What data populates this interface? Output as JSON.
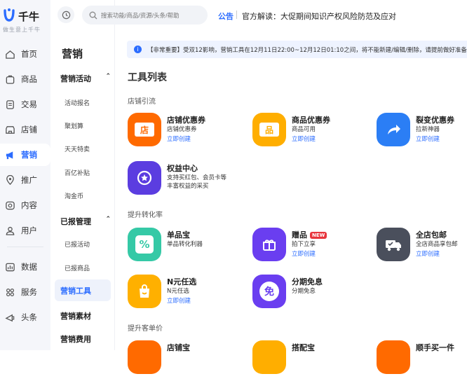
{
  "brand": {
    "name": "千牛",
    "slogan": "做生意上千牛"
  },
  "rail": [
    {
      "label": "首页",
      "icon": "home-icon"
    },
    {
      "label": "商品",
      "icon": "goods-icon"
    },
    {
      "label": "交易",
      "icon": "trade-icon"
    },
    {
      "label": "店铺",
      "icon": "shop-icon"
    },
    {
      "label": "营销",
      "icon": "megaphone-icon",
      "active": true
    },
    {
      "label": "推广",
      "icon": "location-icon"
    },
    {
      "label": "内容",
      "icon": "content-icon"
    },
    {
      "label": "用户",
      "icon": "user-icon"
    },
    {
      "label": "数据",
      "icon": "data-icon"
    },
    {
      "label": "服务",
      "icon": "service-icon"
    },
    {
      "label": "头条",
      "icon": "news-icon"
    }
  ],
  "subnav": {
    "title": "营销",
    "groups": [
      {
        "label": "营销活动",
        "items": [
          "活动报名",
          "聚划算",
          "天天特卖",
          "百亿补贴",
          "淘金币"
        ]
      },
      {
        "label": "已报管理",
        "items": [
          "已报活动",
          "已报商品"
        ]
      }
    ],
    "active": "营销工具",
    "after": [
      "营销素材",
      "营销费用"
    ]
  },
  "topbar": {
    "search_placeholder": "搜索功能/商品/资源/头条/帮助",
    "notice_label": "公告",
    "notice_text": "官方解读：大促期间知识产权风险防范及应对"
  },
  "banner": "【非常重要】受双12影响，营销工具在12月11日22:00~12月12日01:10之间，将不能新建/编辑/删除，请提前做好准备",
  "tools_title": "工具列表",
  "sections": [
    {
      "title": "店铺引流",
      "tools": [
        {
          "name": "店铺优惠券",
          "desc": "店铺优惠券",
          "link": "立即创建",
          "color": "#ff6a00",
          "glyph": "店",
          "icon": "shop-coupon-icon"
        },
        {
          "name": "商品优惠券",
          "desc": "商品可用",
          "link": "立即创建",
          "color": "#ffae00",
          "glyph": "品",
          "icon": "goods-coupon-icon"
        },
        {
          "name": "裂变优惠券",
          "desc": "拉新神器",
          "link": "立即创建",
          "color": "#2b7ef5",
          "glyph": "",
          "icon": "share-arrow-icon"
        },
        {
          "name": "权益中心",
          "desc": "支持买红包、会员卡等\n丰富权益的采买",
          "link": "",
          "color": "#5b3de0",
          "glyph": "",
          "icon": "star-badge-icon"
        }
      ]
    },
    {
      "title": "提升转化率",
      "tools": [
        {
          "name": "单品宝",
          "desc": "单品转化利器",
          "link": "",
          "color": "#35c9a6",
          "glyph": "%",
          "icon": "discount-tag-icon"
        },
        {
          "name": "赠品",
          "desc": "拍下立享",
          "link": "立即创建",
          "color": "#6a3ef0",
          "glyph": "",
          "icon": "gift-icon",
          "badge": "NEW"
        },
        {
          "name": "全店包邮",
          "desc": "全店商品享包邮",
          "link": "立即创建",
          "color": "#4a4f5c",
          "glyph": "",
          "icon": "truck-icon"
        },
        {
          "name": "N元任选",
          "desc": "N元任选",
          "link": "立即创建",
          "color": "#ffb000",
          "glyph": "",
          "icon": "shopping-bag-icon"
        },
        {
          "name": "分期免息",
          "desc": "分期免息",
          "link": "",
          "color": "#6a3ef0",
          "glyph": "免",
          "icon": "interest-free-icon"
        }
      ]
    },
    {
      "title": "提升客单价",
      "tools": [
        {
          "name": "店铺宝",
          "desc": "",
          "link": "",
          "color": "#ff6a00",
          "glyph": "",
          "icon": "shop-treasure-icon"
        },
        {
          "name": "搭配宝",
          "desc": "",
          "link": "",
          "color": "#ffae00",
          "glyph": "",
          "icon": "bundle-icon"
        },
        {
          "name": "顺手买一件",
          "desc": "",
          "link": "",
          "color": "#ff6a00",
          "glyph": "",
          "icon": "buy-one-icon"
        }
      ]
    }
  ]
}
